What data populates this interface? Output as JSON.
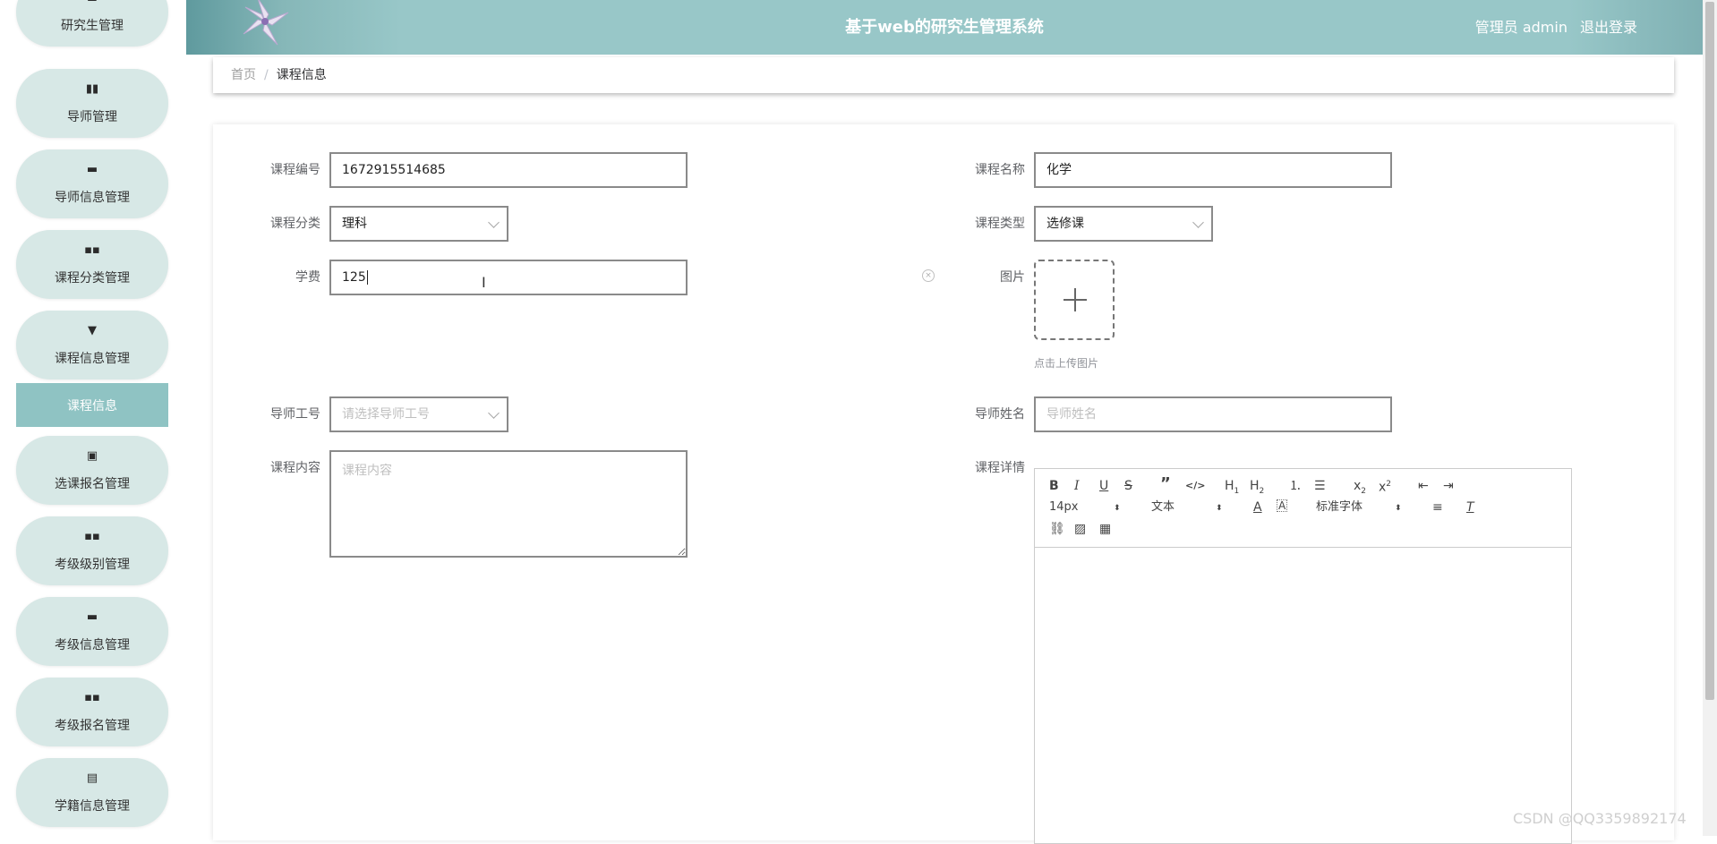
{
  "header": {
    "title": "基于web的研究生管理系统",
    "user_label": "管理员 admin",
    "logout_label": "退出登录"
  },
  "sidebar": {
    "items": [
      {
        "label": "研究生管理",
        "icon": "list-icon",
        "glyph": "☰"
      },
      {
        "label": "导师管理",
        "icon": "book-icon",
        "glyph": "▮▮"
      },
      {
        "label": "导师信息管理",
        "icon": "monitor-icon",
        "glyph": "▬"
      },
      {
        "label": "课程分类管理",
        "icon": "grid-icon",
        "glyph": "▪▪"
      },
      {
        "label": "课程信息管理",
        "icon": "tray-icon",
        "glyph": "▼"
      },
      {
        "label": "选课报名管理",
        "icon": "clipboard-icon",
        "glyph": "▣"
      },
      {
        "label": "考级级别管理",
        "icon": "grid-icon",
        "glyph": "▪▪"
      },
      {
        "label": "考级信息管理",
        "icon": "chat-icon",
        "glyph": "▬"
      },
      {
        "label": "考级报名管理",
        "icon": "grid-icon",
        "glyph": "▪▪"
      },
      {
        "label": "学籍信息管理",
        "icon": "clipboard-icon",
        "glyph": "▤"
      }
    ],
    "active_sub": "课程信息"
  },
  "breadcrumb": {
    "home": "首页",
    "separator": "/",
    "current": "课程信息"
  },
  "form": {
    "course_no": {
      "label": "课程编号",
      "value": "1672915514685"
    },
    "course_name": {
      "label": "课程名称",
      "value": "化学"
    },
    "category": {
      "label": "课程分类",
      "value": "理科"
    },
    "course_type": {
      "label": "课程类型",
      "value": "选修课"
    },
    "fee": {
      "label": "学费",
      "value": "125"
    },
    "image": {
      "label": "图片",
      "tip": "点击上传图片"
    },
    "teacher_no": {
      "label": "导师工号",
      "placeholder": "请选择导师工号"
    },
    "teacher_name": {
      "label": "导师姓名",
      "placeholder": "导师姓名"
    },
    "content": {
      "label": "课程内容",
      "placeholder": "课程内容"
    },
    "detail": {
      "label": "课程详情"
    }
  },
  "editor": {
    "font_size": "14px",
    "heading": "文本",
    "font_family": "标准字体"
  },
  "watermark": "CSDN @QQ3359892174"
}
